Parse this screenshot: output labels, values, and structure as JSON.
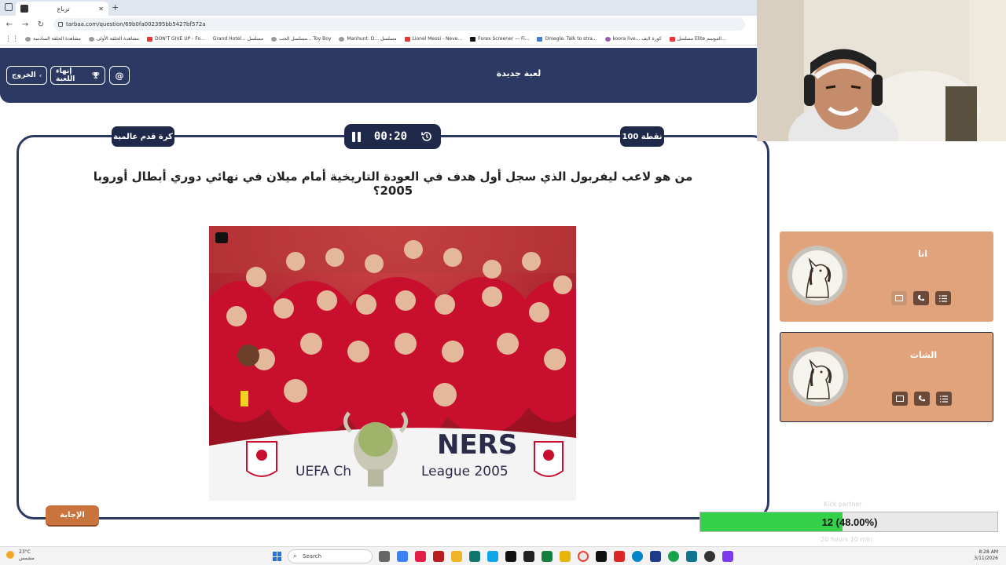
{
  "browser": {
    "tab_title": "ترباع",
    "url": "tarbaa.com/question/69b0fa002395bb5427bf572a",
    "bookmarks": [
      "مشاهدة الحلقة السادسة",
      "مشاهدة الحلقة الأولى",
      "DON'T GIVE UP - Fo...",
      "Grand Hotel... مسلسل",
      "مسلسل الحب... Toy Boy",
      "Manhunt: D... مسلسل",
      "Lionel Messi - Neve...",
      "Forex Screener — Fi...",
      "Omegle: Talk to stra...",
      "koora live... كورة لايف",
      "مسلسل Elite الموسم..."
    ]
  },
  "header": {
    "exit_label": "الخروج",
    "end_game_label": "إنهاء اللعبة",
    "new_game_label": "لعبة جديدة"
  },
  "question_card": {
    "category": "كرة قدم عالمية",
    "timer": "00:20",
    "points": "100 نقطة",
    "question": "من هو لاعب ليفربول الذي سجل أول هدف في العودة التاريخية أمام ميلان في نهائي دوري أبطال أوروبا 2005؟",
    "image_banner_partial": "NERS",
    "image_banner_sub": "UEFA Ch",
    "image_banner_sub2": "League 2005",
    "answer_button": "الإجابة"
  },
  "players": [
    {
      "name": "انا"
    },
    {
      "name": "الشات"
    }
  ],
  "overlay": {
    "progress_text": "12 (48.00%)",
    "progress_fraction": 0.48,
    "progress_color": "#33d04a",
    "ghost_top": "Kick partner",
    "ghost_bottom": "20 hours 10 min"
  },
  "taskbar": {
    "temp": "23°C",
    "weather_text": "مشمس",
    "search_placeholder": "Search",
    "time": "8:28 AM",
    "date": "3/11/2026"
  }
}
